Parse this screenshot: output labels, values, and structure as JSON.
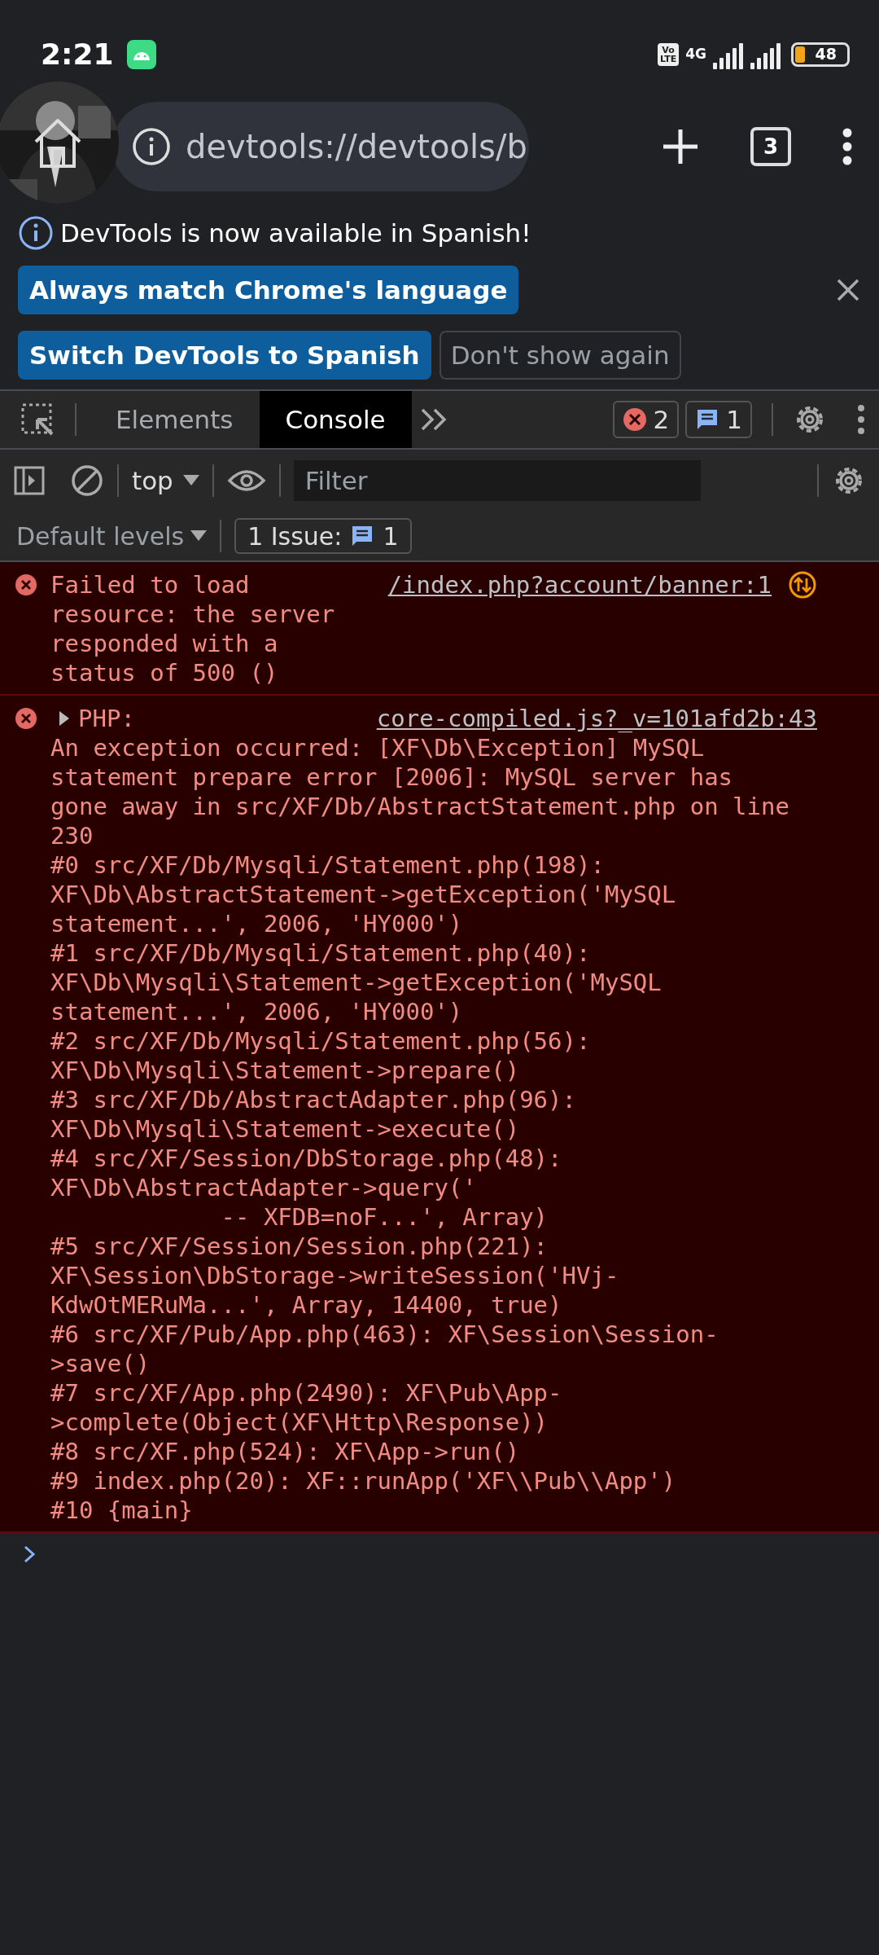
{
  "status_bar": {
    "time": "2:21",
    "volte": [
      "Vo",
      "LTE"
    ],
    "network": "4G",
    "battery": "48"
  },
  "browser": {
    "url": "devtools://devtools/b",
    "tab_count": "3"
  },
  "infobar": {
    "message": "DevTools is now available in Spanish!",
    "buttons": [
      {
        "label": "Always match Chrome's language",
        "kind": "primary"
      },
      {
        "label": "Switch DevTools to Spanish",
        "kind": "primary"
      },
      {
        "label": "Don't show again",
        "kind": "secondary"
      }
    ]
  },
  "devtools_tabs": [
    {
      "label": "Elements",
      "selected": false
    },
    {
      "label": "Console",
      "selected": true
    }
  ],
  "counters": {
    "errors": "2",
    "messages": "1"
  },
  "console_toolbar": {
    "context": "top",
    "filter_placeholder": "Filter"
  },
  "levels": {
    "label": "Default levels",
    "issues_label": "1 Issue:",
    "issues_count": "1"
  },
  "messages": [
    {
      "kind": "error",
      "network": true,
      "text": "Failed to load resource: the server responded with a status of 500 ()",
      "source": "/index.php?account/banner:1"
    },
    {
      "kind": "error",
      "expanded": false,
      "summary": "PHP:",
      "source": "core-compiled.js?_v=101afd2b:43",
      "detail": "An exception occurred: [XF\\Db\\Exception] MySQL statement prepare error [2006]: MySQL server has gone away in src/XF/Db/AbstractStatement.php on line 230\n#0 src/XF/Db/Mysqli/Statement.php(198): XF\\Db\\AbstractStatement->getException('MySQL statement...', 2006, 'HY000')\n#1 src/XF/Db/Mysqli/Statement.php(40): XF\\Db\\Mysqli\\Statement->getException('MySQL statement...', 2006, 'HY000')\n#2 src/XF/Db/Mysqli/Statement.php(56): XF\\Db\\Mysqli\\Statement->prepare()\n#3 src/XF/Db/AbstractAdapter.php(96): XF\\Db\\Mysqli\\Statement->execute()\n#4 src/XF/Session/DbStorage.php(48): XF\\Db\\AbstractAdapter->query('\n            -- XFDB=noF...', Array)\n#5 src/XF/Session/Session.php(221): XF\\Session\\DbStorage->writeSession('HVj-KdwOtMERuMa...', Array, 14400, true)\n#6 src/XF/Pub/App.php(463): XF\\Session\\Session->save()\n#7 src/XF/App.php(2490): XF\\Pub\\App->complete(Object(XF\\Http\\Response))\n#8 src/XF.php(524): XF\\App->run()\n#9 index.php(20): XF::runApp('XF\\\\Pub\\\\App')\n#10 {main}"
    }
  ]
}
